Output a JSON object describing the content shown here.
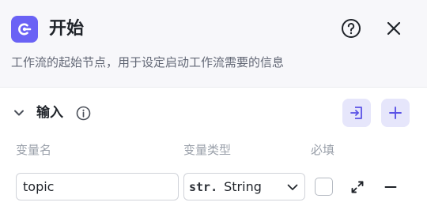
{
  "node": {
    "icon": "start-node-icon",
    "title": "开始",
    "description": "工作流的起始节点，用于设定启动工作流需要的信息",
    "accent_color": "#6a62f5"
  },
  "header_actions": {
    "help_icon": "question-circle-icon",
    "close_icon": "close-icon"
  },
  "inputs_section": {
    "title": "输入",
    "info_icon": "info-circle-icon",
    "import_icon": "import-icon",
    "add_icon": "plus-icon",
    "columns": {
      "name": "变量名",
      "type": "变量类型",
      "required": "必填"
    },
    "rows": [
      {
        "name": "topic",
        "type_prefix": "str.",
        "type": "String",
        "required": false
      }
    ]
  }
}
